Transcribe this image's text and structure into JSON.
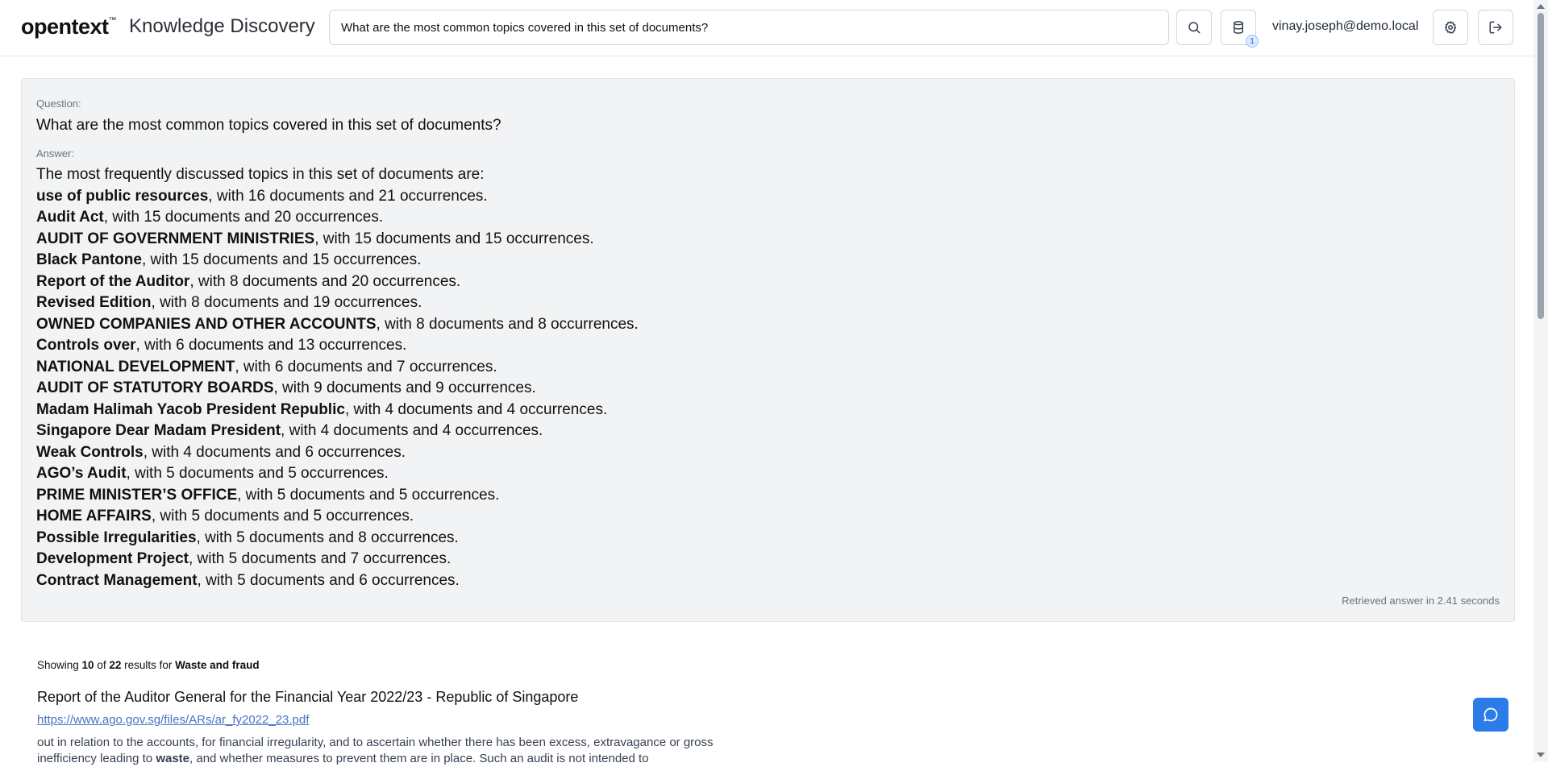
{
  "header": {
    "logo": "opentext",
    "logo_tm": "™",
    "app_title": "Knowledge Discovery",
    "search_value": "What are the most common topics covered in this set of documents?",
    "data_badge_count": "1",
    "user": "vinay.joseph@demo.local",
    "icons": [
      "search-icon",
      "database-icon",
      "gear-icon",
      "logout-icon"
    ]
  },
  "answer_card": {
    "question_label": "Question:",
    "question": "What are the most common topics covered in this set of documents?",
    "answer_label": "Answer:",
    "intro": "The most frequently discussed topics in this set of documents are:",
    "topics": [
      {
        "term": "use of public resources",
        "detail": ", with 16 documents and 21 occurrences."
      },
      {
        "term": "Audit Act",
        "detail": ", with 15 documents and 20 occurrences."
      },
      {
        "term": "AUDIT OF GOVERNMENT MINISTRIES",
        "detail": ", with 15 documents and 15 occurrences."
      },
      {
        "term": "Black Pantone",
        "detail": ", with 15 documents and 15 occurrences."
      },
      {
        "term": "Report of the Auditor",
        "detail": ", with 8 documents and 20 occurrences."
      },
      {
        "term": "Revised Edition",
        "detail": ", with 8 documents and 19 occurrences."
      },
      {
        "term": "OWNED COMPANIES AND OTHER ACCOUNTS",
        "detail": ", with 8 documents and 8 occurrences."
      },
      {
        "term": "Controls over",
        "detail": ", with 6 documents and 13 occurrences."
      },
      {
        "term": "NATIONAL DEVELOPMENT",
        "detail": ", with 6 documents and 7 occurrences."
      },
      {
        "term": "AUDIT OF STATUTORY BOARDS",
        "detail": ", with 9 documents and 9 occurrences."
      },
      {
        "term": "Madam Halimah Yacob President Republic",
        "detail": ", with 4 documents and 4 occurrences."
      },
      {
        "term": "Singapore Dear Madam President",
        "detail": ", with 4 documents and 4 occurrences."
      },
      {
        "term": "Weak Controls",
        "detail": ", with 4 documents and 6 occurrences."
      },
      {
        "term": "AGO’s Audit",
        "detail": ", with 5 documents and 5 occurrences."
      },
      {
        "term": "PRIME MINISTER’S OFFICE",
        "detail": ", with 5 documents and 5 occurrences."
      },
      {
        "term": "HOME AFFAIRS",
        "detail": ", with 5 documents and 5 occurrences."
      },
      {
        "term": "Possible Irregularities",
        "detail": ", with 5 documents and 8 occurrences."
      },
      {
        "term": "Development Project",
        "detail": ", with 5 documents and 7 occurrences."
      },
      {
        "term": "Contract Management",
        "detail": ", with 5 documents and 6 occurrences."
      }
    ],
    "retrieved": "Retrieved answer in 2.41 seconds"
  },
  "results": {
    "showing_prefix": "Showing ",
    "shown": "10",
    "of_text": " of ",
    "total": "22",
    "for_text": " results for ",
    "query": "Waste and fraud",
    "items": [
      {
        "title": "Report of the Auditor General for the Financial Year 2022/23 - Republic of Singapore",
        "url": "https://www.ago.gov.sg/files/ARs/ar_fy2022_23.pdf",
        "snippet_before": "out in relation to the accounts, for financial irregularity, and to ascertain whether there has been excess, extravagance or gross inefficiency leading to ",
        "snippet_highlight": "waste",
        "snippet_after": ", and whether measures to prevent them are in place. Such an audit is not intended to"
      }
    ]
  },
  "chat": {
    "icon": "chat-icon"
  }
}
